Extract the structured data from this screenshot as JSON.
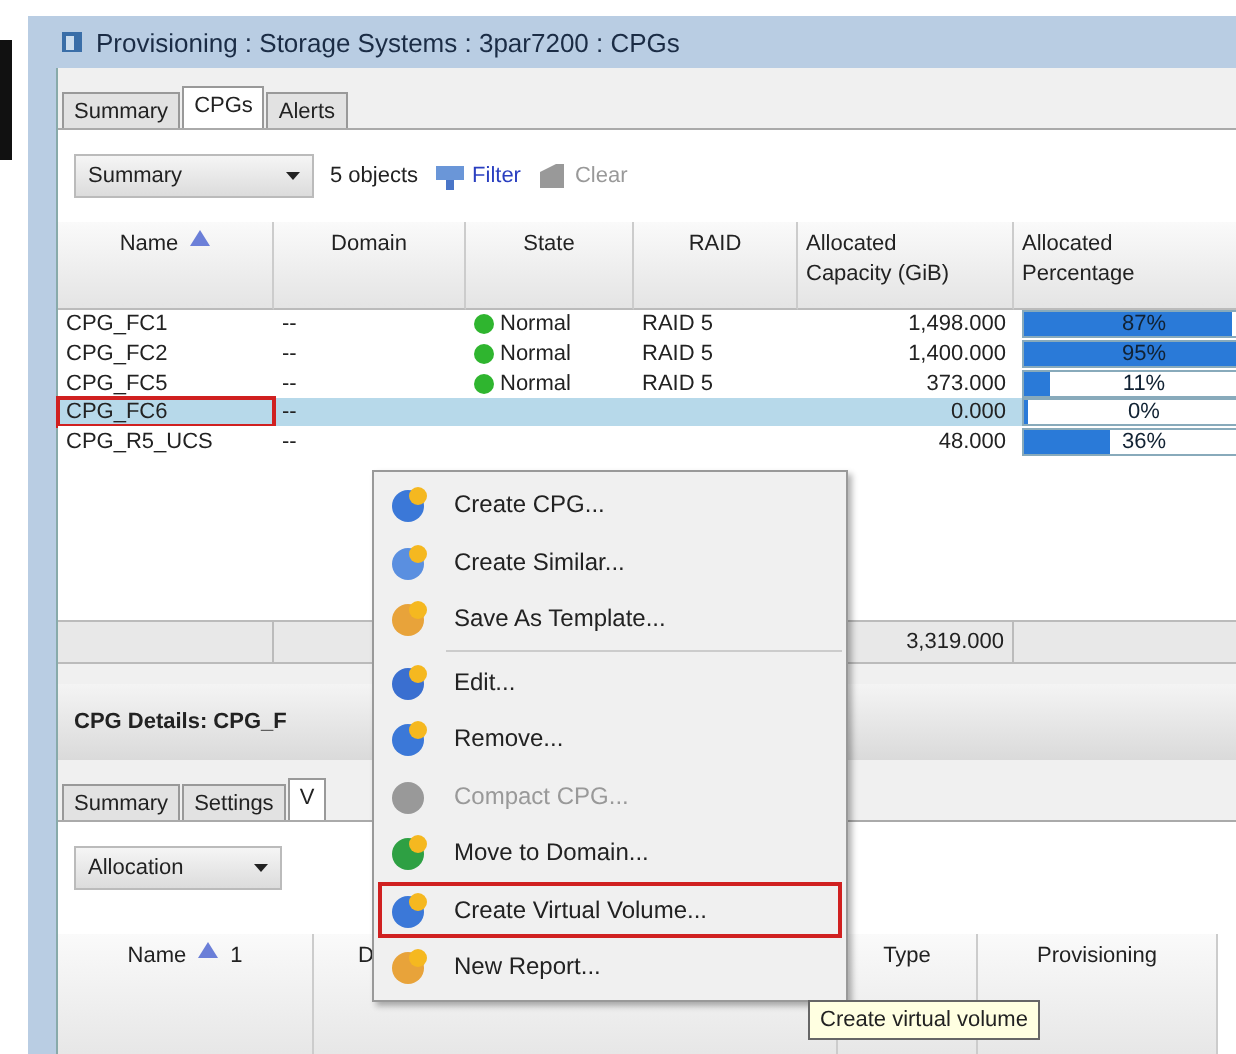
{
  "window": {
    "title": "Provisioning : Storage Systems : 3par7200 : CPGs"
  },
  "tabs": [
    {
      "label": "Summary",
      "selected": false
    },
    {
      "label": "CPGs",
      "selected": true
    },
    {
      "label": "Alerts",
      "selected": false
    }
  ],
  "toolbar": {
    "view": "Summary",
    "count": "5 objects",
    "filter": "Filter",
    "clear": "Clear",
    "clear_disabled": true
  },
  "table": {
    "columns": [
      "Name",
      "Domain",
      "State",
      "RAID",
      "Allocated Capacity (GiB)",
      "Allocated Percentage"
    ],
    "rows": [
      {
        "name": "CPG_FC1",
        "domain": "--",
        "state": "Normal",
        "raid": "RAID 5",
        "capacity": "1,498.000",
        "percent": "87%",
        "level": 0.87,
        "selected": false,
        "marked": false
      },
      {
        "name": "CPG_FC2",
        "domain": "--",
        "state": "Normal",
        "raid": "RAID 5",
        "capacity": "1,400.000",
        "percent": "95%",
        "level": 0.95,
        "selected": false,
        "marked": false
      },
      {
        "name": "CPG_FC5",
        "domain": "--",
        "state": "Normal",
        "raid": "RAID 5",
        "capacity": "373.000",
        "percent": "11%",
        "level": 0.11,
        "selected": false,
        "marked": false
      },
      {
        "name": "CPG_FC6",
        "domain": "--",
        "capacity": "0.000",
        "percent": "0%",
        "level": 0,
        "selected": true,
        "marked": true
      },
      {
        "name": "CPG_R5_UCS",
        "domain": "--",
        "capacity": "48.000",
        "percent": "36%",
        "level": 0.36,
        "selected": false,
        "marked": false
      }
    ],
    "total": "3,319.000"
  },
  "details": {
    "title": "CPG Details: CPG_F",
    "tabs": [
      {
        "label": "Summary",
        "selected": false
      },
      {
        "label": "Settings",
        "selected": false
      },
      {
        "label": "V",
        "selected": true
      }
    ],
    "view": "Allocation",
    "columns": [
      "Name",
      "D",
      "Type",
      "Provisioning"
    ],
    "sort_rank": "1"
  },
  "context_menu": [
    {
      "items": [
        {
          "label": "Create CPG...",
          "disabled": false,
          "marked": false
        },
        {
          "label": "Create Similar...",
          "disabled": false,
          "marked": false
        },
        {
          "label": "Save As Template...",
          "disabled": false,
          "marked": false
        }
      ]
    },
    {
      "items": [
        {
          "label": "Edit...",
          "disabled": false,
          "marked": false
        },
        {
          "label": "Remove...",
          "disabled": false,
          "marked": false
        },
        {
          "label": "Compact CPG...",
          "disabled": true,
          "marked": false
        },
        {
          "label": "Move to Domain...",
          "disabled": false,
          "marked": false
        },
        {
          "label": "Create Virtual Volume...",
          "disabled": false,
          "marked": true
        },
        {
          "label": "New Report...",
          "disabled": false,
          "marked": false
        }
      ]
    }
  ],
  "tooltip": "Create virtual volume"
}
